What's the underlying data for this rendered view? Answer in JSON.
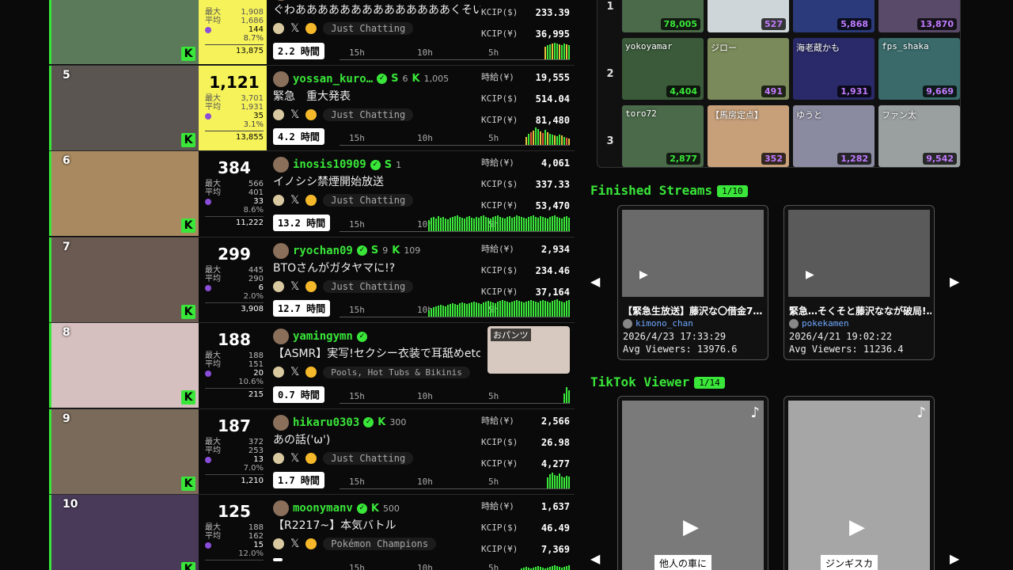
{
  "rankings": [
    {
      "rank": "",
      "viewers": "",
      "max": "1,908",
      "avg": "1,686",
      "chat": "144",
      "pct": "8.7%",
      "total": "13,875",
      "top": true,
      "username": "",
      "title": "ぐわああああああああああああああくそい",
      "category": "Just Chatting",
      "hours": "2.2 時間",
      "m_hour": "",
      "m_usd": "233.39",
      "m_jpy": "36,995",
      "bars": [
        16,
        18,
        19,
        20,
        21,
        20,
        19,
        18,
        20,
        19,
        18
      ]
    },
    {
      "rank": "5",
      "viewers": "1,121",
      "max": "3,701",
      "avg": "1,931",
      "chat": "35",
      "pct": "3.1%",
      "total": "13,855",
      "top": true,
      "username": "yossan_kuro…",
      "s": "6",
      "k": "1,005",
      "title": "緊急　重大発表",
      "category": "Just Chatting",
      "hours": "4.2 時間",
      "m_hour": "19,555",
      "m_usd": "514.04",
      "m_jpy": "81,480",
      "bars": [
        10,
        14,
        16,
        18,
        22,
        20,
        17,
        15,
        19,
        16,
        14,
        13,
        12,
        11,
        13,
        12,
        10,
        9,
        8
      ]
    },
    {
      "rank": "6",
      "viewers": "384",
      "max": "566",
      "avg": "401",
      "chat": "33",
      "pct": "8.6%",
      "total": "11,222",
      "top": false,
      "username": "inosis10909",
      "s": "1",
      "k": "",
      "title": "イノシシ禁煙開始放送",
      "category": "Just Chatting",
      "hours": "13.2 時間",
      "m_hour": "4,061",
      "m_usd": "337.33",
      "m_jpy": "53,470",
      "bars": [
        14,
        17,
        18,
        16,
        19,
        17,
        18,
        16,
        15,
        17,
        18,
        19,
        20,
        18,
        17,
        16,
        18,
        19,
        17,
        16,
        18,
        17,
        19,
        20,
        18,
        17,
        16,
        18,
        19,
        20,
        18,
        17,
        16,
        18,
        19,
        17,
        18,
        20,
        19,
        18,
        17,
        16,
        18,
        19,
        20,
        18,
        17,
        19,
        18,
        17,
        16,
        18,
        19,
        20,
        18,
        17,
        16,
        18,
        19,
        17
      ]
    },
    {
      "rank": "7",
      "viewers": "299",
      "max": "445",
      "avg": "290",
      "chat": "6",
      "pct": "2.0%",
      "total": "3,908",
      "top": false,
      "username": "ryochan09",
      "s": "9",
      "k": "109",
      "title": "BTOさんがガタヤマに!?",
      "category": "Just Chatting",
      "hours": "12.7 時間",
      "m_hour": "2,934",
      "m_usd": "234.46",
      "m_jpy": "37,164",
      "bars": [
        8,
        10,
        12,
        13,
        14,
        15,
        14,
        13,
        15,
        16,
        17,
        16,
        15,
        17,
        18,
        17,
        16,
        17,
        18,
        19,
        18,
        17,
        16,
        18,
        19,
        20,
        19,
        18,
        17,
        19,
        20,
        21,
        20,
        19,
        18,
        19,
        20,
        21,
        20,
        19,
        18,
        19,
        20,
        21,
        20,
        19,
        18,
        20,
        21,
        20,
        19,
        18,
        20,
        21,
        22,
        20,
        19,
        18,
        20,
        21
      ]
    },
    {
      "rank": "8",
      "viewers": "188",
      "max": "188",
      "avg": "151",
      "chat": "20",
      "pct": "10.6%",
      "total": "215",
      "top": false,
      "username": "yamingymn",
      "s": "",
      "k": "",
      "title": "【ASMR】実写!セクシー衣装で耳舐めetc",
      "category": "Pools, Hot Tubs & Bikinis",
      "hours": "0.7 時間",
      "m_hour": "",
      "m_usd": "",
      "m_jpy": "",
      "thumb_label": "おパンツ",
      "bars": [
        12,
        20,
        16
      ]
    },
    {
      "rank": "9",
      "viewers": "187",
      "max": "372",
      "avg": "253",
      "chat": "13",
      "pct": "7.0%",
      "total": "1,210",
      "top": false,
      "username": "hikaru0303",
      "s": "",
      "k": "300",
      "title": "あの話('ω')",
      "category": "Just Chatting",
      "hours": "1.7 時間",
      "m_hour": "2,566",
      "m_usd": "26.98",
      "m_jpy": "4,277",
      "bars": [
        14,
        18,
        20,
        17,
        16,
        19,
        15,
        14,
        16,
        15
      ]
    },
    {
      "rank": "10",
      "viewers": "125",
      "max": "188",
      "avg": "162",
      "chat": "15",
      "pct": "12.0%",
      "total": "",
      "top": false,
      "username": "moonymanv",
      "s": "",
      "k": "500",
      "title": "【R2217~】本気バトル",
      "category": "Pokémon Champions",
      "hours": "",
      "m_hour": "1,637",
      "m_usd": "46.49",
      "m_jpy": "7,369",
      "bars": [
        6,
        8,
        9,
        10,
        9,
        8,
        9,
        10,
        11,
        10,
        9,
        8,
        9,
        10,
        11,
        12,
        11,
        10,
        9,
        10,
        11,
        12
      ]
    }
  ],
  "labels": {
    "max": "最大",
    "avg": "平均",
    "m_hour": "時給(¥)",
    "m_usd": "KCIP($)",
    "m_jpy": "KCIP(¥)",
    "t15": "15h",
    "t10": "10h",
    "t5": "5h",
    "k": "K"
  },
  "grid": {
    "rows": [
      "1",
      "2",
      "3"
    ],
    "cells": [
      {
        "name": "",
        "count": "78,005",
        "style": "green"
      },
      {
        "name": "",
        "count": "527",
        "style": "purple"
      },
      {
        "name": "",
        "count": "5,868",
        "style": "purple"
      },
      {
        "name": "",
        "count": "13,870",
        "style": "purple"
      },
      {
        "name": "yokoyamar",
        "count": "4,404",
        "style": "green"
      },
      {
        "name": "ジロー",
        "count": "491",
        "style": "purple"
      },
      {
        "name": "海老蔵かも",
        "count": "1,931",
        "style": "purple"
      },
      {
        "name": "fps_shaka",
        "count": "9,669",
        "style": "purple"
      },
      {
        "name": "toro72",
        "count": "2,877",
        "style": "green"
      },
      {
        "name": "【馬房定点】",
        "count": "352",
        "style": "purple"
      },
      {
        "name": "ゆうと",
        "count": "1,282",
        "style": "purple"
      },
      {
        "name": "ファン太",
        "count": "9,542",
        "style": "purple"
      }
    ]
  },
  "finished": {
    "title": "Finished Streams",
    "badge": "1/10",
    "cards": [
      {
        "title": "【緊急生放送】藤沢な〇借金7…",
        "channel": "kimono_chan",
        "date": "2026/4/23 17:33:29",
        "avg": "Avg Viewers: 13976.6"
      },
      {
        "title": "緊急…そくそと藤沢ななが破局!…",
        "channel": "pokekamen",
        "date": "2026/4/21 19:02:22",
        "avg": "Avg Viewers: 11236.4"
      }
    ]
  },
  "tiktok": {
    "title": "TikTok Viewer",
    "badge": "1/14",
    "cards": [
      {
        "caption": "他人の車に"
      },
      {
        "caption": "ジンギスカ"
      }
    ]
  }
}
